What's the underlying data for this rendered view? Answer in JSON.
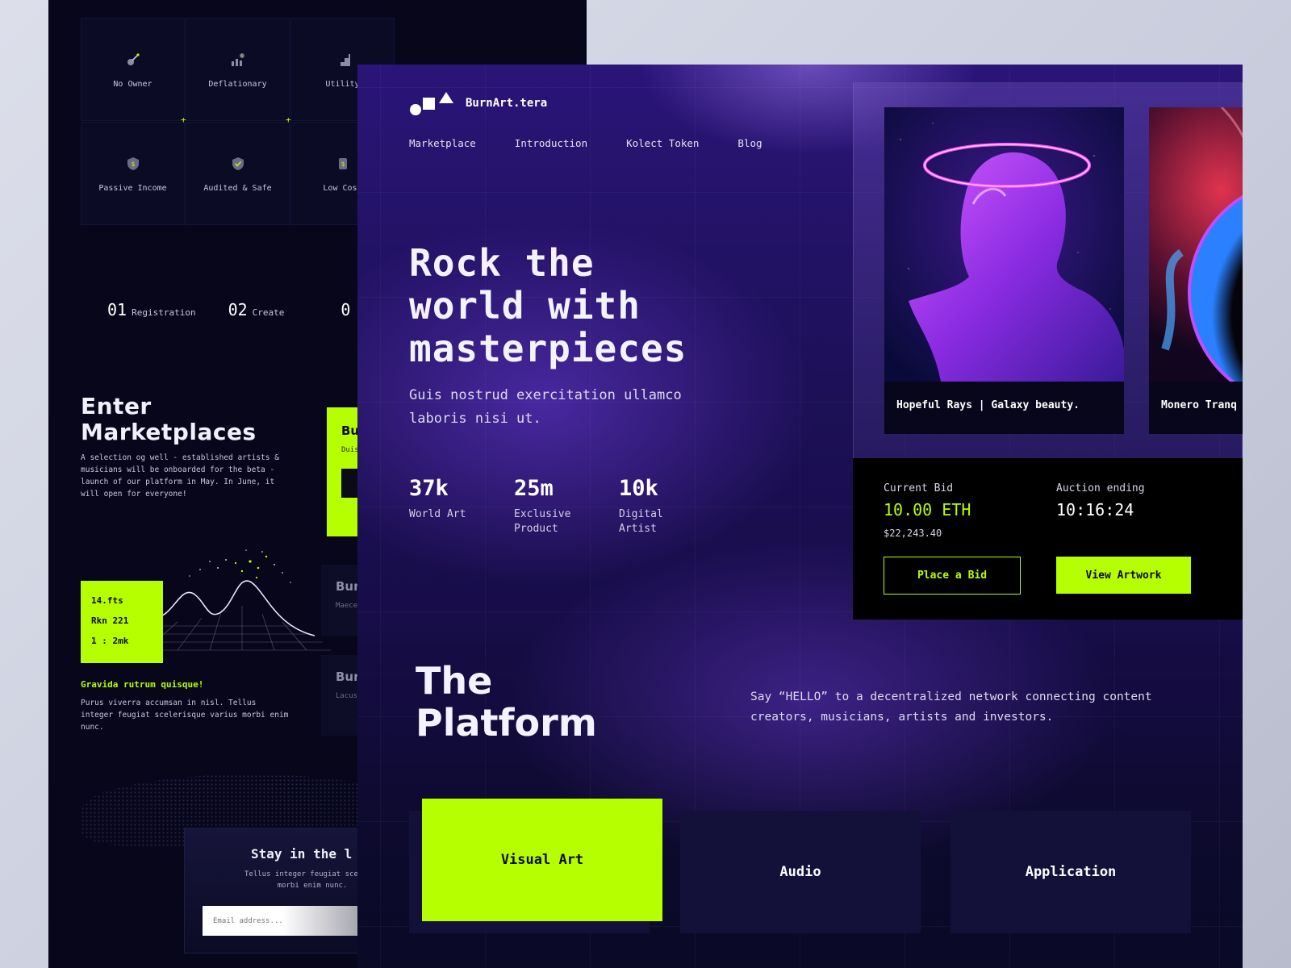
{
  "back": {
    "features": [
      {
        "label": "No Owner",
        "icon": "guitar-icon"
      },
      {
        "label": "Deflationary",
        "icon": "chart-coin-icon"
      },
      {
        "label": "Utility",
        "icon": "stairs-icon"
      },
      {
        "label": "Passive Income",
        "icon": "coin-shield-icon"
      },
      {
        "label": "Audited & Safe",
        "icon": "shield-check-icon"
      },
      {
        "label": "Low Cost",
        "icon": "coin-tag-icon"
      }
    ],
    "steps": [
      {
        "num": "01",
        "label": "Registration"
      },
      {
        "num": "02",
        "label": "Create"
      },
      {
        "num": "0",
        "label": ""
      }
    ],
    "enter_title_1": "Enter",
    "enter_title_2": "Marketplaces",
    "enter_desc": "A selection og well - established artists & musicians will be onboarded for the beta - launch of our platform in May. In June, it will open for everyone!",
    "chart_lines": [
      "14.fts",
      "Rkn 221",
      "1 : 2mk"
    ],
    "grav_title": "Gravida rutrum quisque!",
    "grav_desc": "Purus viverra accumsan in nisl. Tellus integer feugiat scelerisque varius morbi enim nunc.",
    "card_green": {
      "title": "Bu",
      "desc": "Duis volu null"
    },
    "card_dark_1": {
      "title": "Bur",
      "desc": "Maece leo u"
    },
    "card_dark_2": {
      "title": "Bur",
      "desc": "Lacus scele fauci"
    },
    "newsletter": {
      "title": "Stay in the l",
      "desc_1": "Tellus integer feugiat sceleris",
      "desc_2": "morbi enim nunc.",
      "placeholder": "Email address..."
    }
  },
  "front": {
    "brand": "BurnArt.tera",
    "nav": [
      "Marketplace",
      "Introduction",
      "Kolect Token",
      "Blog"
    ],
    "hero_title_1": "Rock the",
    "hero_title_2": "world with",
    "hero_title_3": "masterpieces",
    "hero_sub": "Guis nostrud exercitation ullamco laboris nisi ut.",
    "stats": [
      {
        "value": "37k",
        "label": "World Art"
      },
      {
        "value": "25m",
        "label": "Exclusive Product"
      },
      {
        "value": "10k",
        "label": "Digital Artist"
      }
    ],
    "art_cards": [
      {
        "caption": "Hopeful Rays | Galaxy beauty."
      },
      {
        "caption": "Monero Tranq"
      }
    ],
    "bid": {
      "current_label": "Current Bid",
      "current_value": "10.00 ETH",
      "current_usd": "$22,243.40",
      "auction_label": "Auction ending",
      "auction_value": "10:16:24",
      "place_bid": "Place a Bid",
      "view_artwork": "View Artwork"
    },
    "platform_title_1": "The",
    "platform_title_2": "Platform",
    "platform_desc": "Say “HELLO” to a decentralized network connecting content creators, musicians, artists and investors.",
    "categories": [
      "Visual Art",
      "Audio",
      "Application"
    ]
  },
  "colors": {
    "accent": "#b6ff00",
    "back_bg": "#07061a",
    "front_bg": "#1d1058",
    "panel": "#000000"
  }
}
